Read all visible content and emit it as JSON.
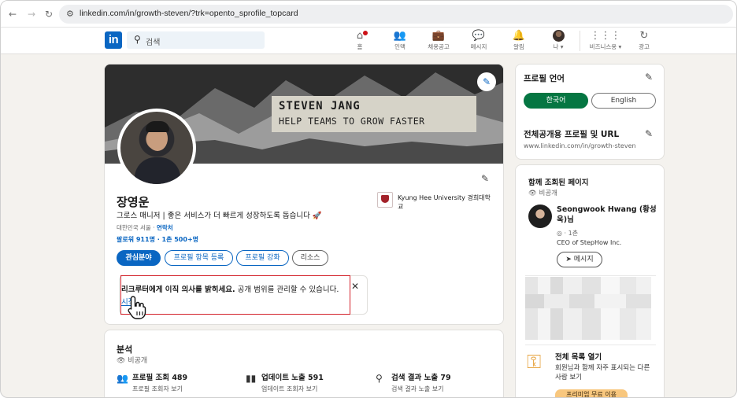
{
  "browser": {
    "back": "←",
    "forward": "→",
    "reload": "↻",
    "url": "linkedin.com/in/growth-steven/?trk=opento_sprofile_topcard"
  },
  "topnav": {
    "logo": "in",
    "search_placeholder": "검색",
    "items": [
      {
        "label": "홈",
        "icon": "home-icon"
      },
      {
        "label": "인맥",
        "icon": "people-icon"
      },
      {
        "label": "채용공고",
        "icon": "briefcase-icon"
      },
      {
        "label": "메시지",
        "icon": "message-icon"
      },
      {
        "label": "알림",
        "icon": "bell-icon"
      },
      {
        "label": "나 ▾",
        "icon": "avatar"
      },
      {
        "label": "비즈니스용 ▾",
        "icon": "grid-icon"
      },
      {
        "label": "광고",
        "icon": "ads-icon"
      }
    ]
  },
  "profile": {
    "banner_line1": "STEVEN JANG",
    "banner_line2": "HELP TEAMS TO GROW FASTER",
    "name": "장영운",
    "headline": "그로스 매니저 | 좋은 서비스가 더 빠르게 성장하도록 돕습니다 🚀",
    "location": "대한민국 서울 · ",
    "contact": "연락처",
    "followers": "팔로워 911명 · 1촌 500+명",
    "education": "Kyung Hee University 경희대학교",
    "buttons": {
      "interest": "관심분야",
      "add_section": "프로필 항목 등록",
      "enhance": "프로필 강화",
      "resources": "리소스"
    },
    "opento": {
      "bold": "리크루터에게 이직 의사를 밝히세요.",
      "rest": " 공개 범위를 관리할 수 있습니다.",
      "start": "시작"
    }
  },
  "analytics": {
    "title": "분석",
    "private": "비공개",
    "metrics": [
      {
        "title": "프로필 조회 489",
        "sub": "프로필 조회자 보기"
      },
      {
        "title": "업데이트 노출 591",
        "sub": "업데이트 조회자 보기"
      },
      {
        "title": "검색 결과 노출 79",
        "sub": "검색 결과 노출 보기"
      }
    ]
  },
  "right": {
    "lang_title": "프로필 언어",
    "lang_active": "한국어",
    "lang_inactive": "English",
    "public_title": "전체공개용 프로필 및 URL",
    "public_url": "www.linkedin.com/in/growth-steven",
    "viewed_title": "함께 조회된 페이지",
    "viewed_private": "비공개",
    "person_name": "Seongwook Hwang (황성욱)님",
    "person_degree": "1촌",
    "person_role": "CEO of StepHow Inc.",
    "message_btn": "메시지",
    "fulllist_title": "전체 목록 열기",
    "fulllist_text": "회원님과 함께 자주 표시되는 다른 사람 보기",
    "premium": "프리미엄 무료 이용"
  }
}
